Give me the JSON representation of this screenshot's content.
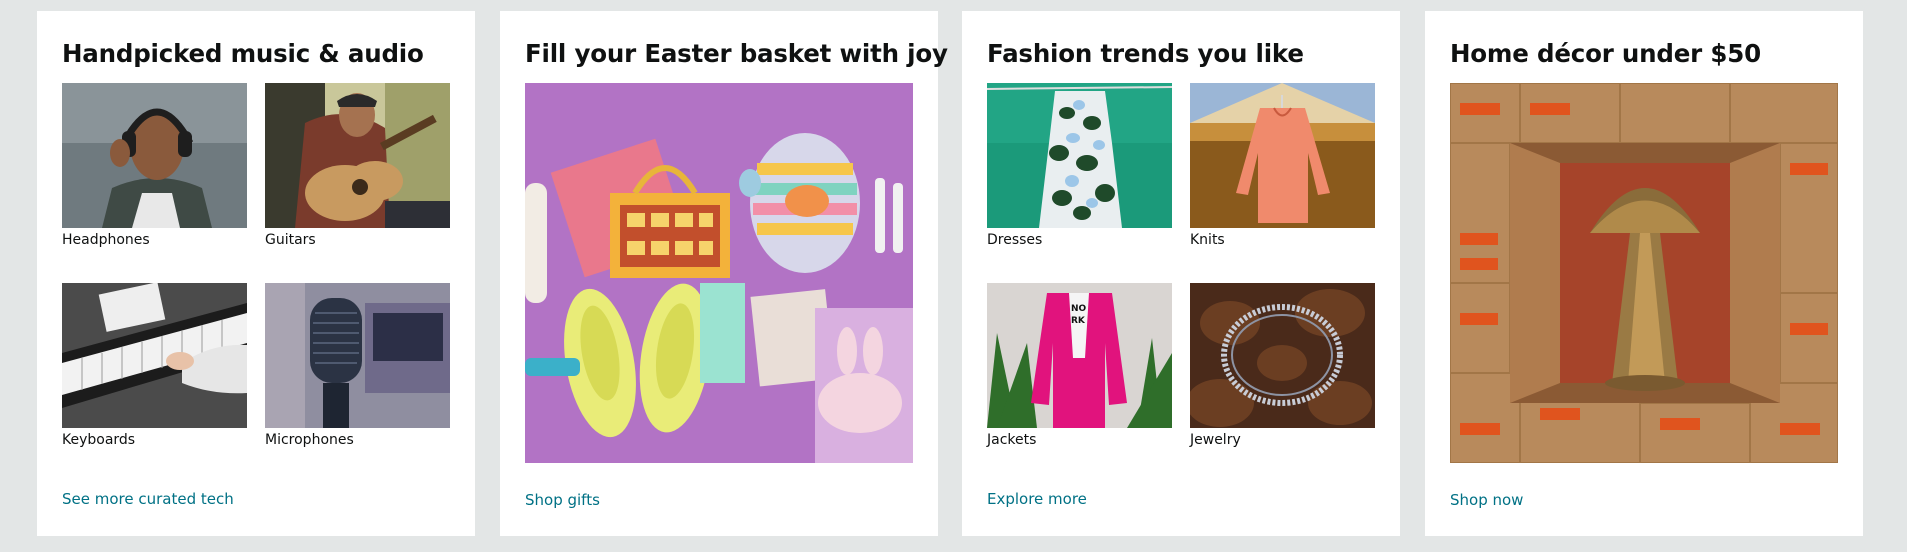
{
  "cards": [
    {
      "title": "Handpicked music & audio",
      "tiles": [
        {
          "label": "Headphones",
          "image": "person-wearing-headphones"
        },
        {
          "label": "Guitars",
          "image": "person-playing-guitar"
        },
        {
          "label": "Keyboards",
          "image": "hands-on-digital-piano"
        },
        {
          "label": "Microphones",
          "image": "studio-microphone"
        }
      ],
      "link": "See more curated tech"
    },
    {
      "title": "Fill your Easter basket with joy",
      "hero": {
        "image": "easter-basket-flatlay"
      },
      "link": "Shop gifts"
    },
    {
      "title": "Fashion trends you like",
      "tiles": [
        {
          "label": "Dresses",
          "image": "floral-dress-on-hanger"
        },
        {
          "label": "Knits",
          "image": "coral-knit-top-on-hanger"
        },
        {
          "label": "Jackets",
          "image": "pink-blazer-with-palms"
        },
        {
          "label": "Jewelry",
          "image": "rhinestone-necklace-on-fur"
        }
      ],
      "link": "Explore more"
    },
    {
      "title": "Home décor under $50",
      "hero": {
        "image": "brass-lamp-in-amazon-boxes"
      },
      "link": "Shop now"
    }
  ],
  "colors": {
    "background": "#e3e6e6",
    "card": "#ffffff",
    "link": "#007185",
    "text": "#0f1111"
  }
}
